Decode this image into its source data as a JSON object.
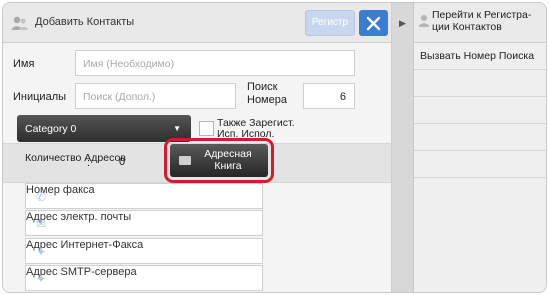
{
  "titlebar": {
    "title": "Добавить Контакты",
    "register_label": "Регистр",
    "title_icon": "contacts-icon",
    "close_icon": "close-icon"
  },
  "form": {
    "name_label": "Имя",
    "name_placeholder": "Имя (Необходимо)",
    "initials_label": "Инициалы",
    "initials_placeholder": "Поиск (Допол.)",
    "search_number_label": "Поиск Номера",
    "search_number_value": "6",
    "category_value": "Category 0",
    "also_register_label": "Также Зарегист. Исп. Испол.",
    "address_count_label": "Количество Адресов",
    "address_count_colon": ":",
    "address_count_value": "0",
    "address_book_label": "Адресная Книга",
    "fax_placeholder": "Номер факса",
    "email_placeholder": "Адрес электр. почты",
    "ifax_placeholder": "Адрес Интернет-Факса",
    "smtp_placeholder": "Адрес SMTP-сервера"
  },
  "sidebar": {
    "goto_label": "Перейти к Регистра- ции Контактов",
    "call_search_label": "Вызвать Номер Поиска"
  },
  "colors": {
    "accent": "#3a7dd3",
    "highlight": "#d7192f",
    "register_disabled": "#c9d7ee"
  }
}
